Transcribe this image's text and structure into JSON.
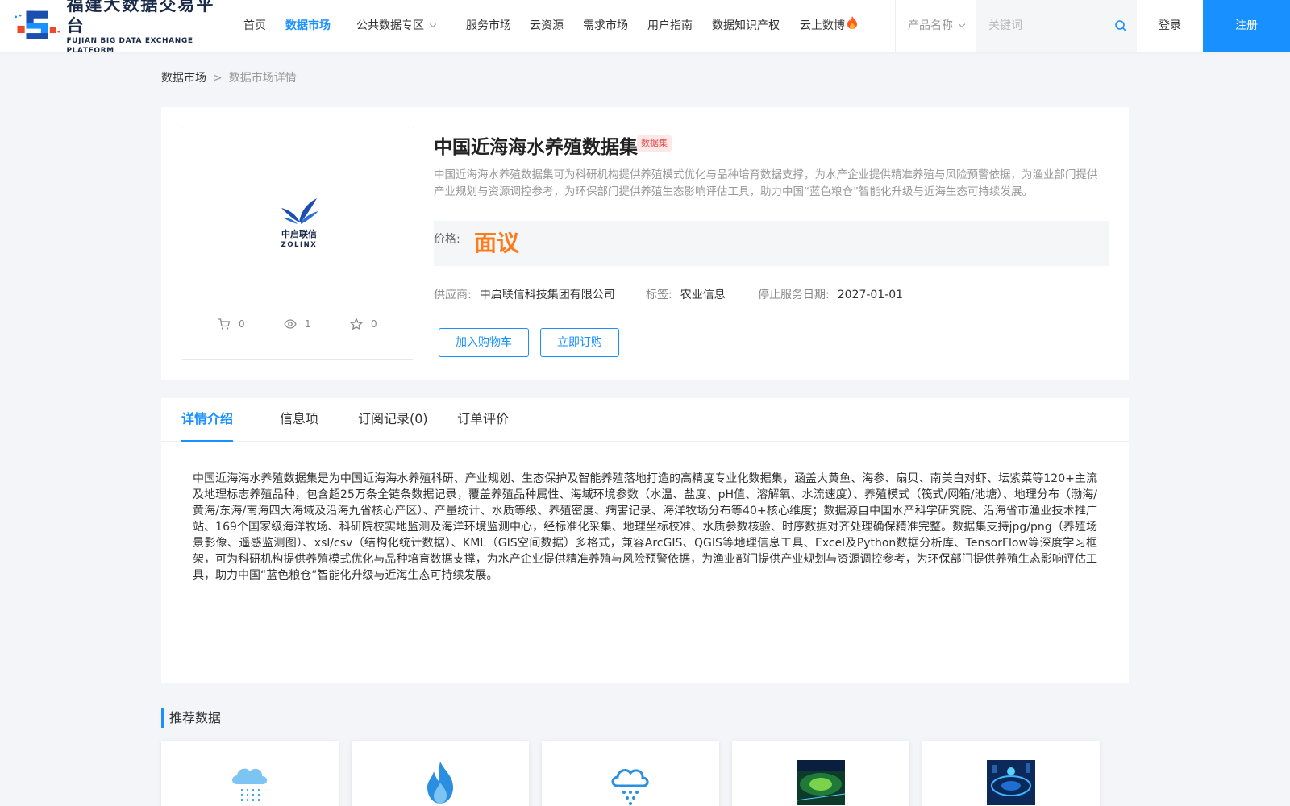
{
  "logo": {
    "cn": "福建大数据交易平台",
    "en": "FUJIAN BIG DATA EXCHANGE PLATFORM"
  },
  "nav": {
    "items": [
      {
        "label": "首页"
      },
      {
        "label": "数据市场"
      },
      {
        "label": "公共数据专区"
      },
      {
        "label": "服务市场"
      },
      {
        "label": "云资源"
      },
      {
        "label": "需求市场"
      },
      {
        "label": "用户指南"
      },
      {
        "label": "数据知识产权"
      },
      {
        "label": "云上数博"
      }
    ],
    "active": "数据市场"
  },
  "search": {
    "category": "产品名称",
    "placeholder": "关键词"
  },
  "auth": {
    "login": "登录",
    "register": "注册"
  },
  "breadcrumb": {
    "parent": "数据市场",
    "separator": ">",
    "current": "数据市场详情"
  },
  "product": {
    "logo_text": "中启联信",
    "logo_en": "ZOLINX",
    "title": "中国近海海水养殖数据集",
    "tag": "数据集",
    "description": "中国近海海水养殖数据集可为科研机构提供养殖模式优化与品种培育数据支撑，为水产企业提供精准养殖与风险预警依据，为渔业部门提供产业规划与资源调控参考，为环保部门提供养殖生态影响评估工具，助力中国“蓝色粮仓”智能化升级与近海生态可持续发展。",
    "price_label": "价格:",
    "price": "面议",
    "supplier_label": "供应商:",
    "supplier": "中启联信科技集团有限公司",
    "tags_label": "标签:",
    "tags": "农业信息",
    "end_label": "停止服务日期:",
    "end_date": "2027-01-01",
    "stats": {
      "cart": "0",
      "views": "1",
      "favorites": "0"
    },
    "add_cart": "加入购物车",
    "subscribe": "立即订购"
  },
  "detail": {
    "tabs": [
      "详情介绍",
      "信息项",
      "订阅记录(0)",
      "订单评价"
    ],
    "active_tab": "详情介绍",
    "text": "中国近海海水养殖数据集是为中国近海海水养殖科研、产业规划、生态保护及智能养殖落地打造的高精度专业化数据集，涵盖大黄鱼、海参、扇贝、南美白对虾、坛紫菜等120+主流及地理标志养殖品种，包含超25万条全链条数据记录，覆盖养殖品种属性、海域环境参数（水温、盐度、pH值、溶解氧、水流速度）、养殖模式（筏式/网箱/池塘）、地理分布（渤海/黄海/东海/南海四大海域及沿海九省核心产区）、产量统计、水质等级、养殖密度、病害记录、海洋牧场分布等40+核心维度；数据源自中国水产科学研究院、沿海省市渔业技术推广站、169个国家级海洋牧场、科研院校实地监测及海洋环境监测中心，经标准化采集、地理坐标校准、水质参数核验、时序数据对齐处理确保精准完整。数据集支持jpg/png（养殖场景影像、遥感监测图）、xsl/csv（结构化统计数据）、KML（GIS空间数据）多格式，兼容ArcGIS、QGIS等地理信息工具、Excel及Python数据分析库、TensorFlow等深度学习框架，可为科研机构提供养殖模式优化与品种培育数据支撑，为水产企业提供精准养殖与风险预警依据，为渔业部门提供产业规划与资源调控参考，为环保部门提供养殖生态影响评估工具，助力中国“蓝色粮仓”智能化升级与近海生态可持续发展。"
  },
  "recommend": {
    "title": "推荐数据",
    "items": [
      {
        "icon": "rain-cloud-icon"
      },
      {
        "icon": "flame-icon"
      },
      {
        "icon": "snow-cloud-icon"
      },
      {
        "icon": "city-photo-icon"
      },
      {
        "icon": "tech-photo-icon"
      }
    ]
  },
  "colors": {
    "primary": "#1890ff",
    "price": "#ff7a1a",
    "tag_bg": "#fde8e8",
    "tag_text": "#e84a4a"
  }
}
